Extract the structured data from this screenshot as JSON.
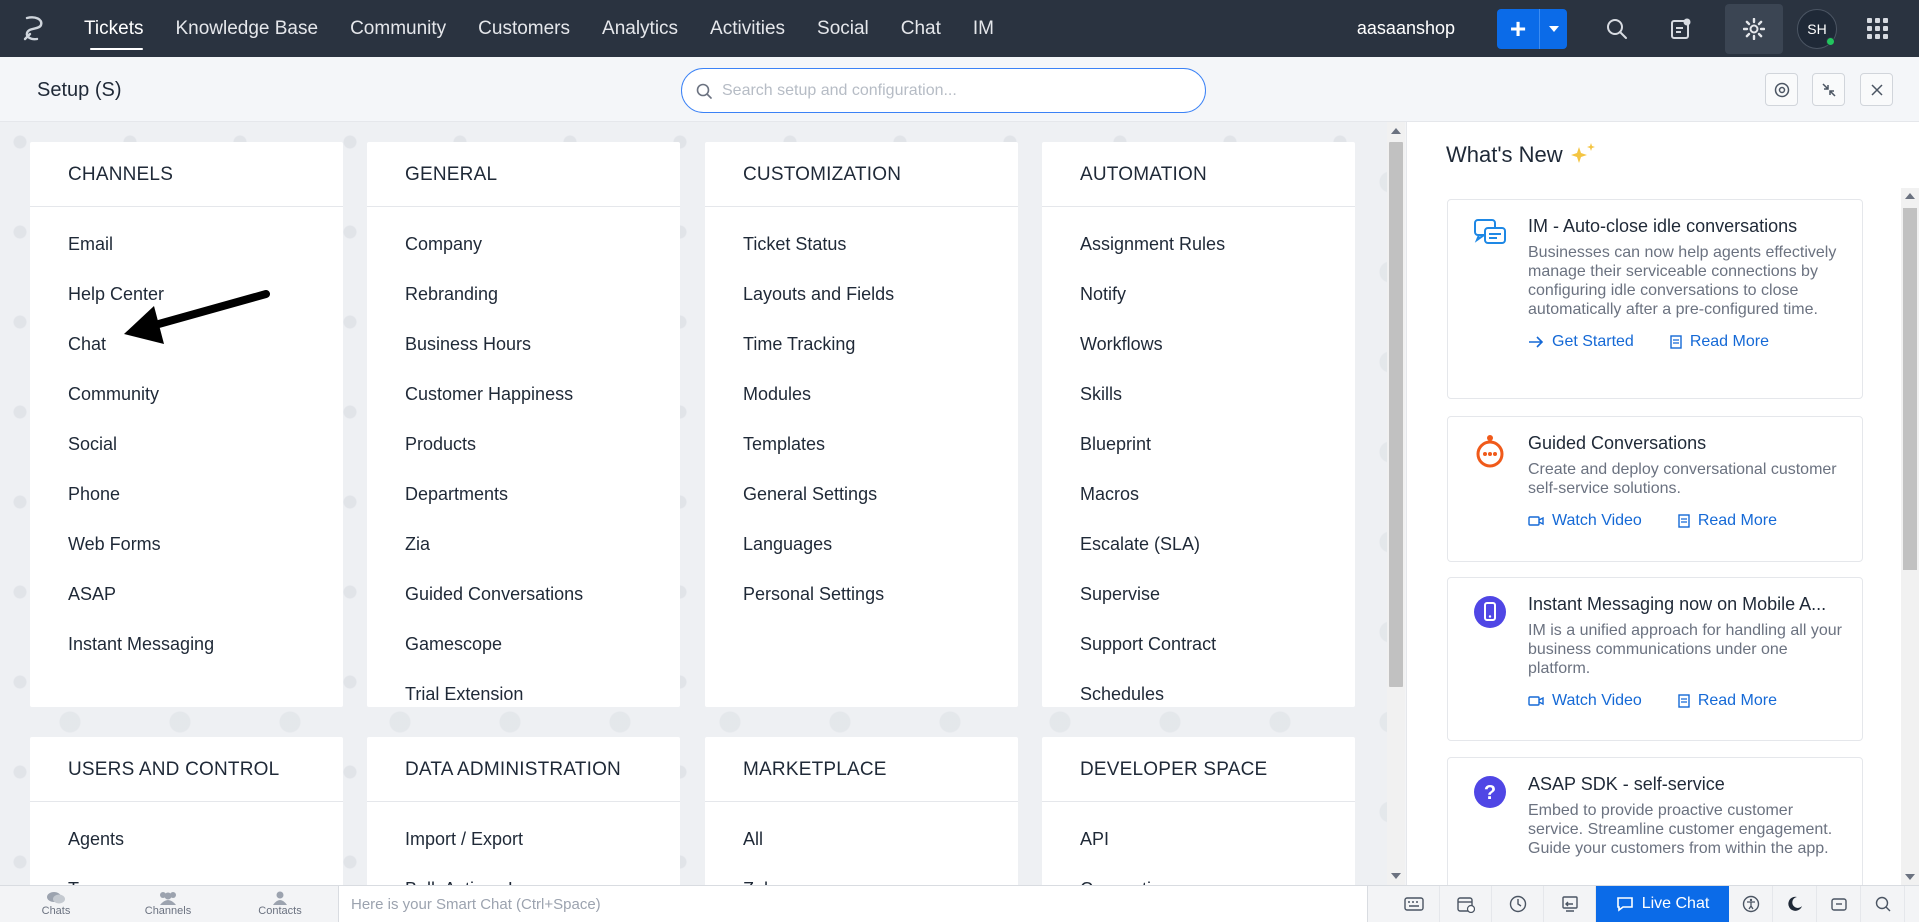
{
  "nav": {
    "tabs": [
      "Tickets",
      "Knowledge Base",
      "Community",
      "Customers",
      "Analytics",
      "Activities",
      "Social",
      "Chat",
      "IM"
    ],
    "active_tab": "Tickets",
    "org_name": "aasaanshop",
    "add_label": "+",
    "avatar_initials": "SH"
  },
  "setup": {
    "title": "Setup (S)",
    "search_placeholder": "Search setup and configuration..."
  },
  "sections": [
    {
      "title": "CHANNELS",
      "items": [
        "Email",
        "Help Center",
        "Chat",
        "Community",
        "Social",
        "Phone",
        "Web Forms",
        "ASAP",
        "Instant Messaging"
      ]
    },
    {
      "title": "GENERAL",
      "items": [
        "Company",
        "Rebranding",
        "Business Hours",
        "Customer Happiness",
        "Products",
        "Departments",
        "Zia",
        "Guided Conversations",
        "Gamescope",
        "Trial Extension"
      ]
    },
    {
      "title": "CUSTOMIZATION",
      "items": [
        "Ticket Status",
        "Layouts and Fields",
        "Time Tracking",
        "Modules",
        "Templates",
        "General Settings",
        "Languages",
        "Personal Settings"
      ]
    },
    {
      "title": "AUTOMATION",
      "items": [
        "Assignment Rules",
        "Notify",
        "Workflows",
        "Skills",
        "Blueprint",
        "Macros",
        "Escalate (SLA)",
        "Supervise",
        "Support Contract",
        "Schedules"
      ]
    },
    {
      "title": "USERS AND CONTROL",
      "items": [
        "Agents",
        "Teams"
      ]
    },
    {
      "title": "DATA ADMINISTRATION",
      "items": [
        "Import / Export",
        "Bulk Actions Log"
      ]
    },
    {
      "title": "MARKETPLACE",
      "items": [
        "All",
        "Zoho"
      ]
    },
    {
      "title": "DEVELOPER SPACE",
      "items": [
        "API",
        "Connections"
      ]
    }
  ],
  "whats_new": {
    "title": "What's New",
    "cards": [
      {
        "icon": "chat-bubbles-icon",
        "title": "IM - Auto-close idle conversations",
        "desc": "Businesses can now help agents effectively manage their serviceable connections by configuring idle conversations to close automatically after a pre-configured time.",
        "links": [
          "Get Started",
          "Read More"
        ]
      },
      {
        "icon": "bot-icon",
        "title": "Guided Conversations",
        "desc": "Create and deploy conversational customer self-service solutions.",
        "links": [
          "Watch Video",
          "Read More"
        ]
      },
      {
        "icon": "mobile-icon",
        "title": "Instant Messaging now on Mobile A...",
        "desc": "IM is a unified approach for handling all your business communications under one platform.",
        "links": [
          "Watch Video",
          "Read More"
        ]
      },
      {
        "icon": "help-icon",
        "title": "ASAP SDK - self-service",
        "desc": "Embed to provide proactive customer service. Streamline customer engagement. Guide your customers from within the app.",
        "links": []
      }
    ]
  },
  "bottom": {
    "tabs": [
      "Chats",
      "Channels",
      "Contacts"
    ],
    "smart_chat_placeholder": "Here is your Smart Chat (Ctrl+Space)",
    "live_chat": "Live Chat"
  }
}
